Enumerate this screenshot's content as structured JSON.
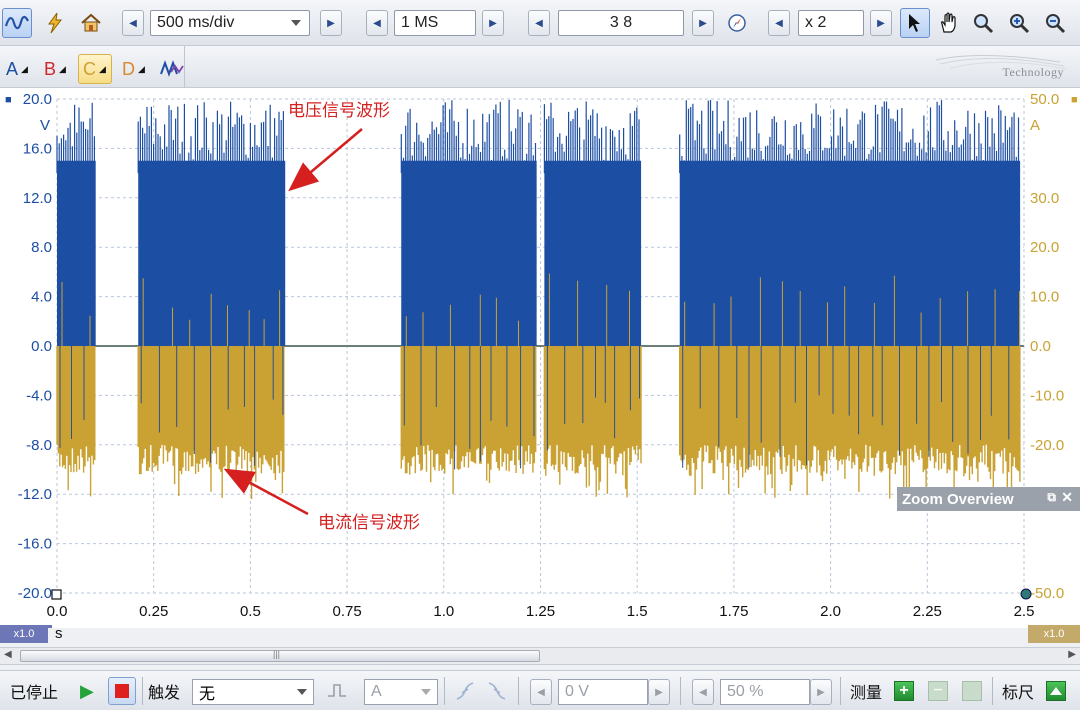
{
  "toolbar": {
    "timebase": "500 ms/div",
    "samples": "1 MS",
    "captures": "3 8",
    "zoom": "x 2"
  },
  "channels": {
    "a": "A",
    "b": "B",
    "c": "C",
    "d": "D"
  },
  "brand": "Technology",
  "plot": {
    "annotation_voltage": "电压信号波形",
    "annotation_current": "电流信号波形",
    "left_unit": "V",
    "right_unit": "A",
    "x_unit": "s",
    "left_zoom_badge": "x1.0",
    "right_zoom_badge": "x1.0",
    "left_ticks": [
      "20.0",
      "16.0",
      "12.0",
      "8.0",
      "4.0",
      "0.0",
      "-4.0",
      "-8.0",
      "-12.0",
      "-16.0",
      "-20.0"
    ],
    "right_ticks": [
      "50.0",
      "40.0",
      "30.0",
      "20.0",
      "10.0",
      "0.0",
      "-10.0",
      "-20.0",
      "-30.0",
      "-40.0",
      "-50.0"
    ],
    "x_ticks": [
      "0.0",
      "0.25",
      "0.5",
      "0.75",
      "1.0",
      "1.25",
      "1.5",
      "1.75",
      "2.0",
      "2.25",
      "2.5"
    ],
    "colors": {
      "voltage": "#1c4ea3",
      "current": "#c9a233",
      "grid": "#b9c7da"
    }
  },
  "zoom_overview": {
    "title": "Zoom Overview"
  },
  "status": {
    "state": "已停止",
    "trigger_label": "触发",
    "trigger_mode": "无",
    "trigger_channel": "A",
    "threshold": "0 V",
    "pre_trigger": "50 %",
    "measure_label": "测量",
    "ruler_label": "标尺"
  },
  "chart_data": {
    "type": "line",
    "x_unit": "s",
    "xlim": [
      0,
      2.5
    ],
    "series": [
      {
        "axis": "left",
        "unit": "V",
        "ylim": [
          -20,
          20
        ],
        "bursts": [
          [
            0.0,
            0.1
          ],
          [
            0.21,
            0.59
          ],
          [
            0.89,
            1.24
          ],
          [
            1.26,
            1.51
          ],
          [
            1.61,
            2.49
          ]
        ],
        "envelope_max": 20.0,
        "envelope_min": -12.0,
        "idle_level": 0.0
      },
      {
        "axis": "right",
        "unit": "A",
        "ylim": [
          -50,
          50
        ],
        "bursts": [
          [
            0.0,
            0.1
          ],
          [
            0.21,
            0.59
          ],
          [
            0.89,
            1.24
          ],
          [
            1.26,
            1.51
          ],
          [
            1.61,
            2.49
          ]
        ],
        "envelope_max": 10.0,
        "envelope_min": -30.0,
        "idle_level": 0.0
      }
    ]
  }
}
